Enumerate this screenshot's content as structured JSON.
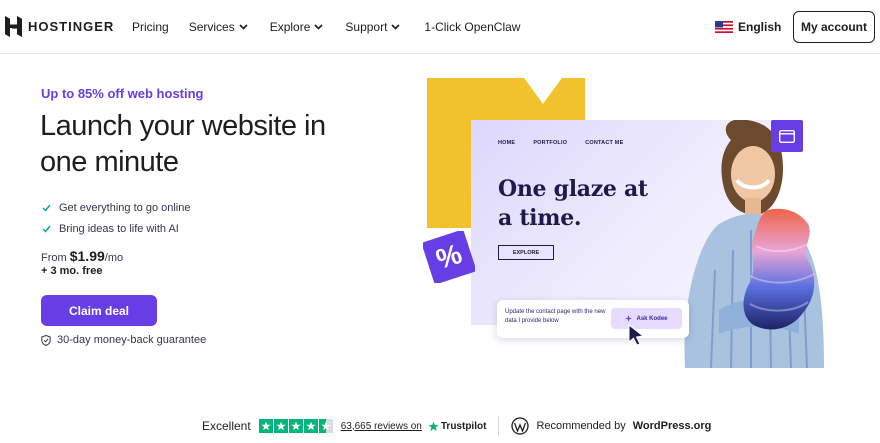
{
  "brand": {
    "name": "HOSTINGER"
  },
  "nav": {
    "links": [
      {
        "label": "Pricing",
        "has_dropdown": false
      },
      {
        "label": "Services",
        "has_dropdown": true
      },
      {
        "label": "Explore",
        "has_dropdown": true
      },
      {
        "label": "Support",
        "has_dropdown": true
      },
      {
        "label": "1-Click OpenClaw",
        "has_dropdown": false
      }
    ],
    "language": {
      "label": "English",
      "flag_icon": "us-flag-icon"
    },
    "account_label": "My account"
  },
  "hero": {
    "promo": "Up to 85% off web hosting",
    "headline": "Launch your website in one minute",
    "features": [
      "Get everything to go online",
      "Bring ideas to life with AI"
    ],
    "price": {
      "prefix": "From",
      "amount": "$1.99",
      "suffix": "/mo"
    },
    "bonus": "+ 3 mo. free",
    "cta_label": "Claim deal",
    "guarantee": "30-day money-back guarantee"
  },
  "artwork": {
    "mock_nav": [
      "HOME",
      "PORTFOLIO",
      "CONTACT ME"
    ],
    "mock_headline": "One glaze at a time.",
    "mock_button": "EXPLORE",
    "chat_prompt": "Update the contact page with the new data I provide below",
    "assistant_button": "Ask Kodee",
    "percent_badge": "%"
  },
  "trust": {
    "rating_label": "Excellent",
    "stars": 4.5,
    "reviews_text": "63,665 reviews on",
    "trustpilot": "Trustpilot",
    "recommended_prefix": "Recommended by",
    "recommended_by": "WordPress.org"
  },
  "colors": {
    "accent": "#673de6",
    "yellow": "#f2c12e",
    "trustpilot_green": "#00b67a",
    "text": "#1d1e20"
  }
}
